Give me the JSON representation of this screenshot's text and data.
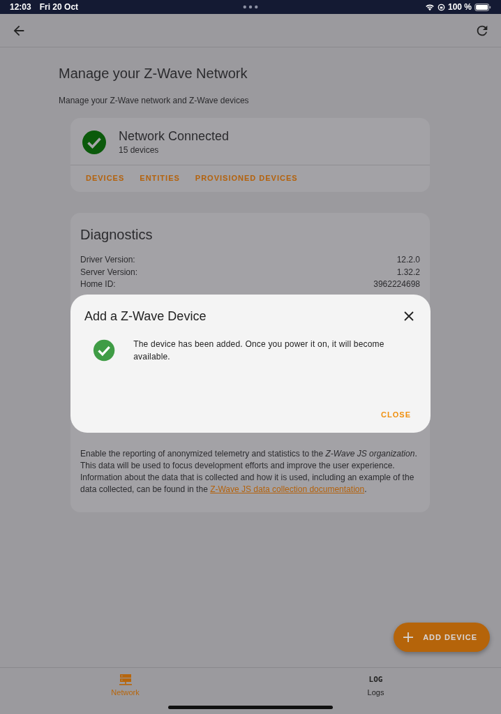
{
  "status_bar": {
    "time": "12:03",
    "date": "Fri 20 Oct",
    "battery": "100 %"
  },
  "page": {
    "title": "Manage your Z-Wave Network",
    "subtitle": "Manage your Z-Wave network and Z-Wave devices"
  },
  "network_card": {
    "status": "Network Connected",
    "count": "15 devices",
    "actions": [
      "DEVICES",
      "ENTITIES",
      "PROVISIONED DEVICES"
    ]
  },
  "diagnostics": {
    "title": "Diagnostics",
    "rows": [
      {
        "label": "Driver Version:",
        "value": "12.2.0"
      },
      {
        "label": "Server Version:",
        "value": "1.32.2"
      },
      {
        "label": "Home ID:",
        "value": "3962224698"
      }
    ]
  },
  "data_reporting": {
    "text_before": "Enable the reporting of anonymized telemetry and statistics to the *Z-Wave JS organization*. This data will be used to focus development efforts and improve the user experience. Information about the data that is collected and how it is used, including an example of the data collected, can be found in the ",
    "link": "Z-Wave JS data collection documentation",
    "text_after": "."
  },
  "dialog": {
    "title": "Add a Z-Wave Device",
    "message": "The device has been added. Once you power it on, it will become available.",
    "button": "CLOSE"
  },
  "fab": {
    "label": "ADD DEVICE"
  },
  "bottom_nav": [
    {
      "kind": "server",
      "label": "Network",
      "selected": true
    },
    {
      "kind": "text",
      "label": "Logs",
      "icon_text": "LOG",
      "selected": false
    }
  ]
}
